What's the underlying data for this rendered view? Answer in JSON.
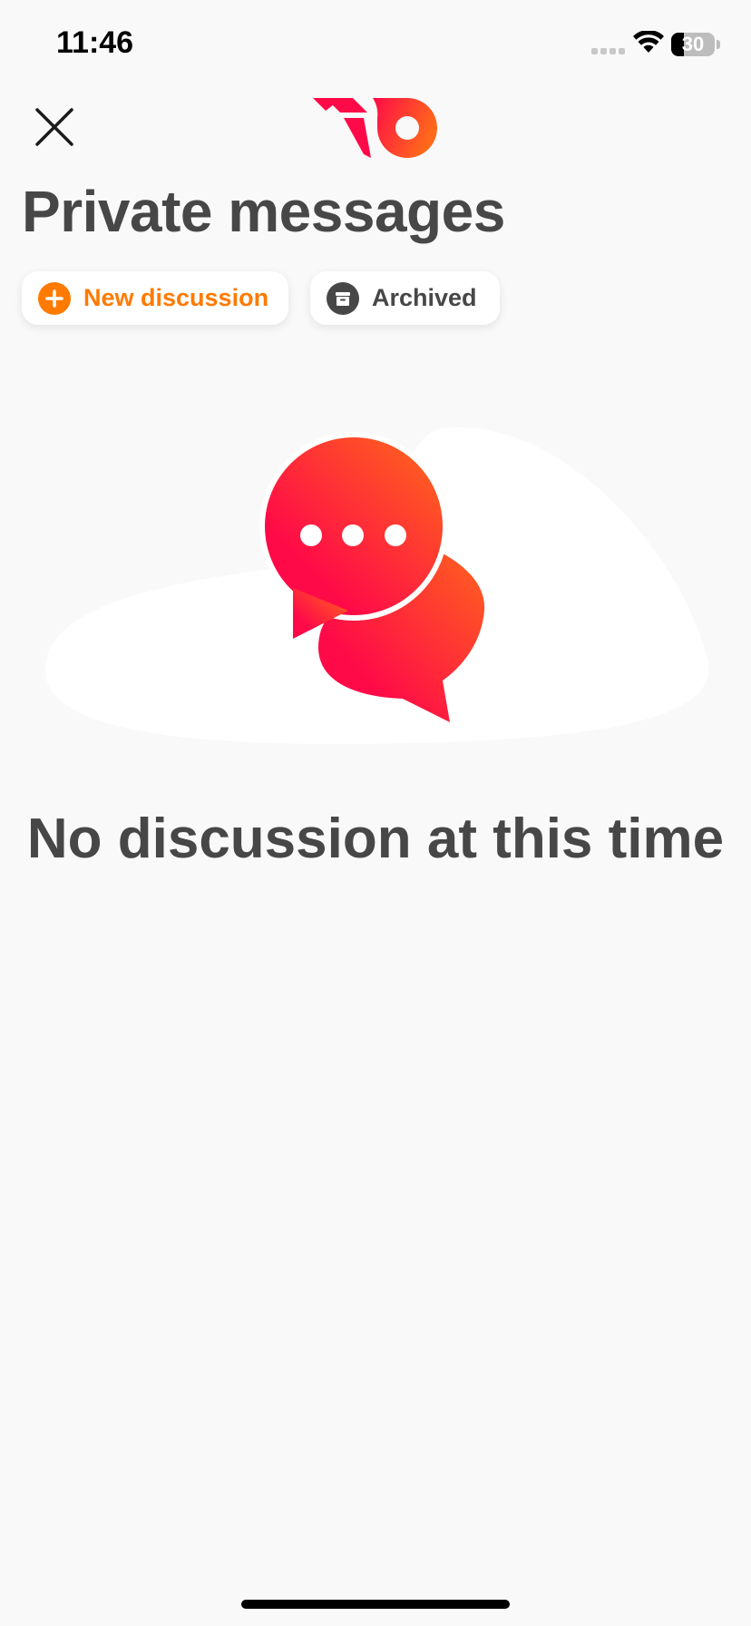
{
  "status_bar": {
    "time": "11:46",
    "battery_level": "30",
    "battery_fraction": 0.3,
    "icons": [
      "cellular-signal-icon",
      "wifi-icon",
      "battery-icon"
    ]
  },
  "header": {
    "close_icon": "close-icon",
    "logo": "brand-logo"
  },
  "page": {
    "title": "Private messages"
  },
  "actions": {
    "new_discussion": {
      "label": "New discussion",
      "icon": "plus-circle-icon",
      "color": "#ff7a00"
    },
    "archived": {
      "label": "Archived",
      "icon": "archive-box-icon",
      "color": "#474747"
    }
  },
  "empty_state": {
    "icon": "chat-bubbles-icon",
    "message": "No discussion at this time"
  },
  "colors": {
    "background": "#f9f9f9",
    "text": "#474747",
    "accent_orange": "#ff7a00",
    "accent_red": "#ff0a48"
  }
}
